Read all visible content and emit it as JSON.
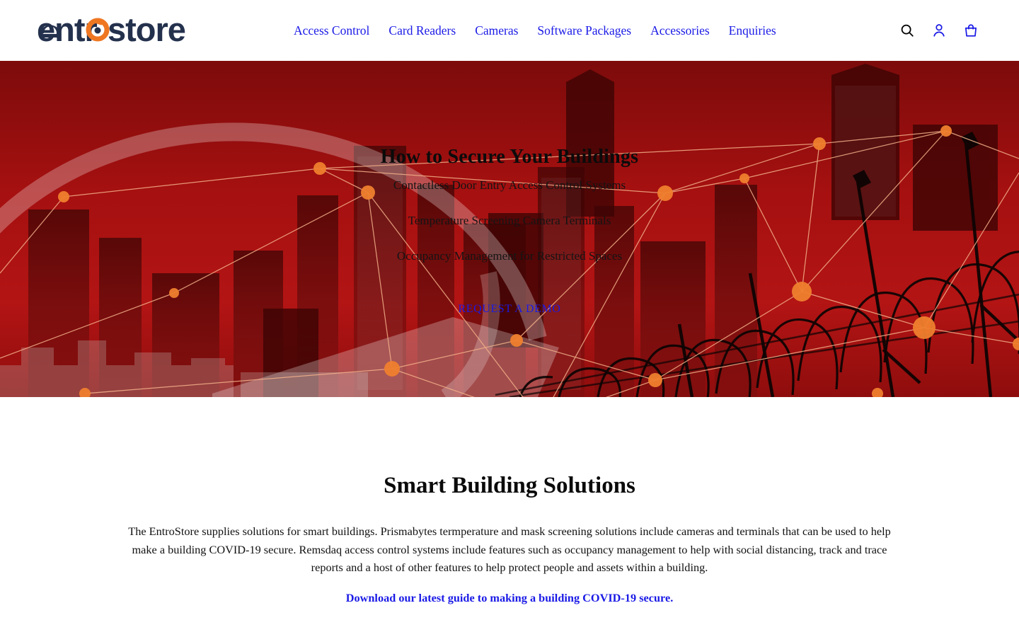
{
  "header": {
    "logo": {
      "text": "entrostore",
      "name": "entrostore-logo",
      "dark_color": "#24314d",
      "accent_color": "#ef7722"
    },
    "nav": [
      {
        "label": "Access Control",
        "name": "nav-link-access-control"
      },
      {
        "label": "Card Readers",
        "name": "nav-link-card-readers"
      },
      {
        "label": "Cameras",
        "name": "nav-link-cameras"
      },
      {
        "label": "Software Packages",
        "name": "nav-link-software-packages"
      },
      {
        "label": "Accessories",
        "name": "nav-link-accessories"
      },
      {
        "label": "Enquiries",
        "name": "nav-link-enquiries"
      }
    ],
    "icons": [
      {
        "name": "search-icon",
        "color": "#000000"
      },
      {
        "name": "account-icon",
        "color": "#1a1ae6"
      },
      {
        "name": "cart-icon",
        "color": "#1a1ae6"
      }
    ],
    "link_color": "#1a1ae6"
  },
  "hero": {
    "title": "How to Secure Your Buildings",
    "lines": [
      "Contactless Door Entry Access Control Systems",
      "Temperature Screening Camera Terminals",
      "Occupancy Management for Restricted Spaces"
    ],
    "cta_label": "REQUEST A DEMO",
    "overlay_color": "#a81010",
    "node_color": "#ef7f2e",
    "link_line_color": "#f0a87a"
  },
  "main": {
    "title": "Smart Building Solutions",
    "body": "The EntroStore supplies solutions for smart buildings. Prismabytes termperature and mask screening solutions include cameras and terminals that can be used to help make a building COVID-19 secure. Remsdaq access control systems include features such as occupancy management to help with social distancing, track and trace reports and a host of other features to help protect people and assets within a building.",
    "download_link": "Download our latest guide to making a building COVID-19 secure."
  }
}
